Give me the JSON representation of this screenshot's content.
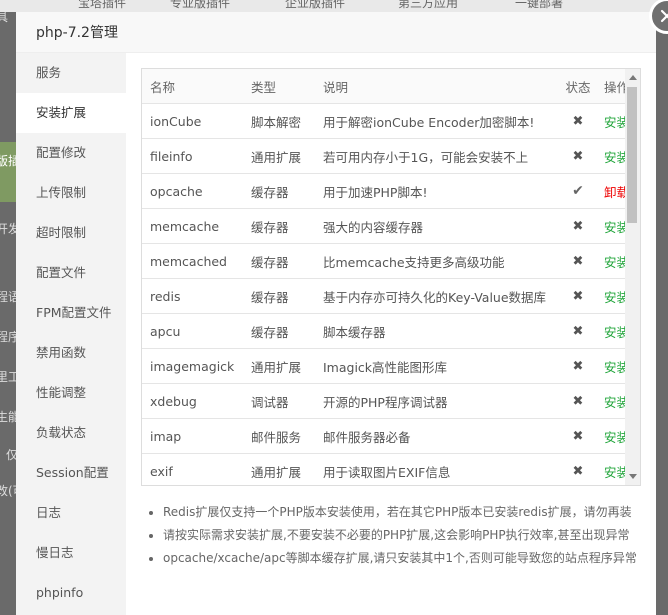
{
  "background": {
    "top_items": [
      "宝塔插件",
      "专业版插件",
      "企业版插件",
      "第三方应用",
      "一键部署"
    ],
    "left_items": [
      "具",
      "版插",
      "开发",
      "程语",
      "程序",
      "里工",
      "生能",
      "仅",
      "改(可"
    ]
  },
  "modal": {
    "title": "php-7.2管理",
    "close_icon": "close-icon"
  },
  "sidebar": {
    "items": [
      {
        "label": "服务",
        "active": false
      },
      {
        "label": "安装扩展",
        "active": true
      },
      {
        "label": "配置修改",
        "active": false
      },
      {
        "label": "上传限制",
        "active": false
      },
      {
        "label": "超时限制",
        "active": false
      },
      {
        "label": "配置文件",
        "active": false
      },
      {
        "label": "FPM配置文件",
        "active": false
      },
      {
        "label": "禁用函数",
        "active": false
      },
      {
        "label": "性能调整",
        "active": false
      },
      {
        "label": "负载状态",
        "active": false
      },
      {
        "label": "Session配置",
        "active": false
      },
      {
        "label": "日志",
        "active": false
      },
      {
        "label": "慢日志",
        "active": false
      },
      {
        "label": "phpinfo",
        "active": false
      }
    ]
  },
  "table": {
    "headers": {
      "name": "名称",
      "type": "类型",
      "desc": "说明",
      "status": "状态",
      "op": "操作"
    },
    "rows": [
      {
        "name": "ionCube",
        "type": "脚本解密",
        "desc": "用于解密ionCube Encoder加密脚本!",
        "installed": false,
        "op": "安装"
      },
      {
        "name": "fileinfo",
        "type": "通用扩展",
        "desc": "若可用内存小于1G，可能会安装不上",
        "installed": false,
        "op": "安装"
      },
      {
        "name": "opcache",
        "type": "缓存器",
        "desc": "用于加速PHP脚本!",
        "installed": true,
        "op": "卸载"
      },
      {
        "name": "memcache",
        "type": "缓存器",
        "desc": "强大的内容缓存器",
        "installed": false,
        "op": "安装"
      },
      {
        "name": "memcached",
        "type": "缓存器",
        "desc": "比memcache支持更多高级功能",
        "installed": false,
        "op": "安装"
      },
      {
        "name": "redis",
        "type": "缓存器",
        "desc": "基于内存亦可持久化的Key-Value数据库",
        "installed": false,
        "op": "安装"
      },
      {
        "name": "apcu",
        "type": "缓存器",
        "desc": "脚本缓存器",
        "installed": false,
        "op": "安装"
      },
      {
        "name": "imagemagick",
        "type": "通用扩展",
        "desc": "Imagick高性能图形库",
        "installed": false,
        "op": "安装"
      },
      {
        "name": "xdebug",
        "type": "调试器",
        "desc": "开源的PHP程序调试器",
        "installed": false,
        "op": "安装"
      },
      {
        "name": "imap",
        "type": "邮件服务",
        "desc": "邮件服务器必备",
        "installed": false,
        "op": "安装"
      },
      {
        "name": "exif",
        "type": "通用扩展",
        "desc": "用于读取图片EXIF信息",
        "installed": false,
        "op": "安装"
      },
      {
        "name": "",
        "type": "",
        "desc": "",
        "installed": null,
        "op": ""
      }
    ]
  },
  "icons": {
    "not_installed": "✖",
    "installed": "✔"
  },
  "notes": [
    "Redis扩展仅支持一个PHP版本安装使用，若在其它PHP版本已安装redis扩展，请勿再装",
    "请按实际需求安装扩展,不要安装不必要的PHP扩展,这会影响PHP执行效率,甚至出现异常",
    "opcache/xcache/apc等脚本缓存扩展,请只安装其中1个,否则可能导致您的站点程序异常"
  ],
  "colors": {
    "install": "#20a53a",
    "uninstall": "#e00000"
  }
}
